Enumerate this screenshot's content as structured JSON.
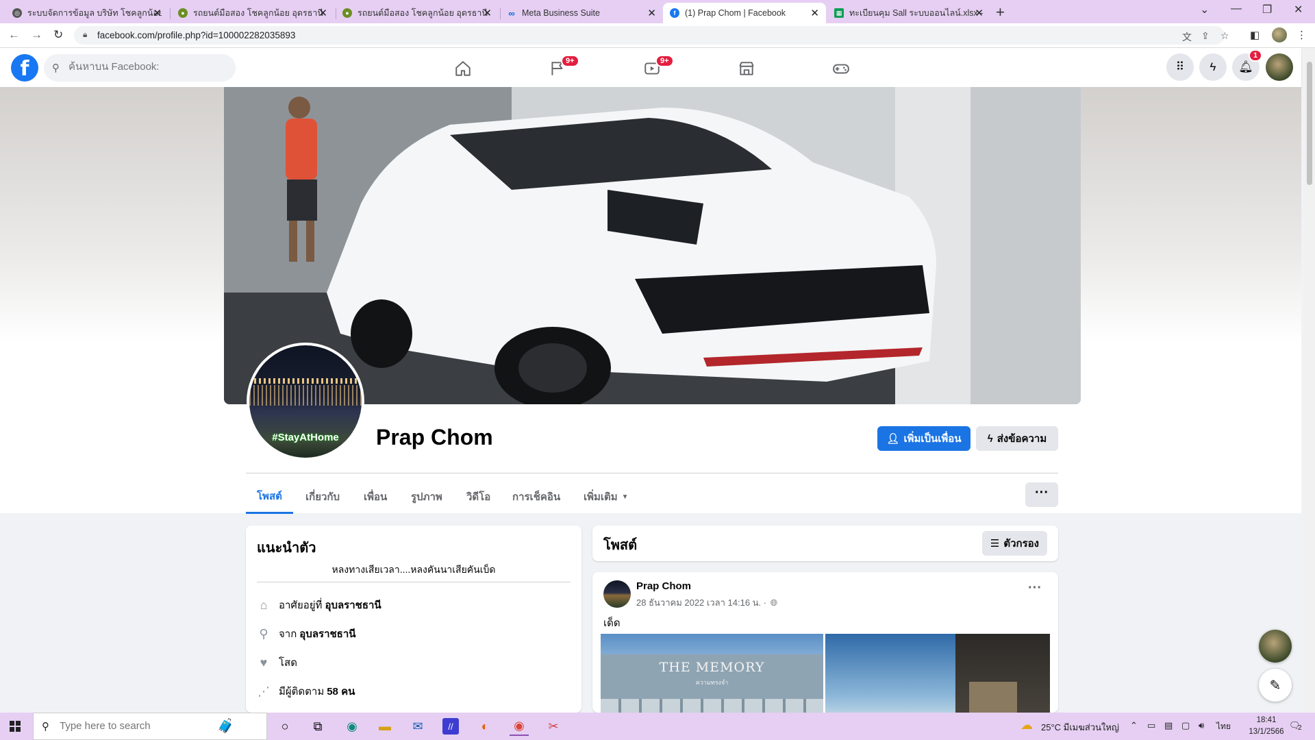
{
  "browser": {
    "tabs": [
      {
        "title": "ระบบจัดการข้อมูล บริษัท โชคลูกน้อย อ",
        "icon": "globe-icon",
        "active": false
      },
      {
        "title": "รถยนต์มือสอง โชคลูกน้อย อุดรธานี",
        "icon": "site-icon",
        "active": false
      },
      {
        "title": "รถยนต์มือสอง โชคลูกน้อย อุดรธานี",
        "icon": "site-icon",
        "active": false
      },
      {
        "title": "Meta Business Suite",
        "icon": "meta-icon",
        "active": false
      },
      {
        "title": "(1) Prap Chom | Facebook",
        "icon": "facebook-icon",
        "active": true
      },
      {
        "title": "ทะเบียนคุม Sall ระบบออนไลน์.xlsx - G",
        "icon": "sheets-icon",
        "active": false
      }
    ],
    "url": "facebook.com/profile.php?id=100002282035893"
  },
  "fb_header": {
    "search_placeholder": "ค้นหาบน Facebook:",
    "badges": {
      "pages": "9+",
      "watch": "9+",
      "notifications": "1"
    }
  },
  "profile": {
    "name": "Prap Chom",
    "avatar_caption": "#StayAtHome",
    "add_friend_label": "เพิ่มเป็นเพื่อน",
    "message_label": "ส่งข้อความ",
    "tabs": [
      "โพสต์",
      "เกี่ยวกับ",
      "เพื่อน",
      "รูปภาพ",
      "วิดีโอ",
      "การเช็คอิน",
      "เพิ่มเติม"
    ],
    "active_tab": "โพสต์",
    "more_label": "···"
  },
  "intro": {
    "title": "แนะนำตัว",
    "bio": "หลงทางเสียเวลา....หลงคันนาเสียคันเบ็ด",
    "rows": [
      {
        "icon": "home-icon",
        "prefix": "อาศัยอยู่ที่",
        "value": "อุบลราชธานี"
      },
      {
        "icon": "location-pin-icon",
        "prefix": "จาก",
        "value": "อุบลราชธานี"
      },
      {
        "icon": "heart-icon",
        "prefix": "โสด",
        "value": ""
      },
      {
        "icon": "rss-icon",
        "prefix": "มีผู้ติดตาม",
        "value": "58 คน"
      }
    ]
  },
  "posts": {
    "title": "โพสต์",
    "filter_label": "ตัวกรอง",
    "first": {
      "author": "Prap Chom",
      "time": "28 ธันวาคม 2022 เวลา 14:16 น. ·",
      "text": "เด็ด",
      "image_sign": "THE MEMORY",
      "image_sign_sub": "ความทรงจำ"
    }
  },
  "taskbar": {
    "search_placeholder": "Type here to search",
    "weather": "25°C  มีเมฆส่วนใหญ่",
    "lang": "ไทย",
    "time": "18:41",
    "date": "13/1/2566",
    "notif_count": "2"
  }
}
